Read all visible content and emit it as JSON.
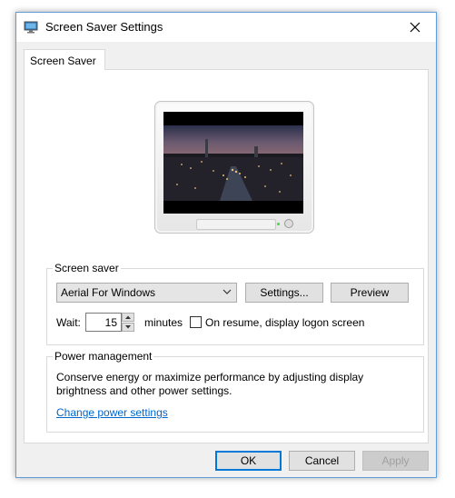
{
  "window": {
    "title": "Screen Saver Settings"
  },
  "tabs": [
    {
      "label": "Screen Saver"
    }
  ],
  "screen_saver": {
    "group_label": "Screen saver",
    "selected": "Aerial For Windows",
    "settings_label": "Settings...",
    "preview_label": "Preview",
    "wait_label": "Wait:",
    "wait_value": "15",
    "minutes_label": "minutes",
    "resume_label": "On resume, display logon screen",
    "resume_checked": false
  },
  "power": {
    "group_label": "Power management",
    "description": "Conserve energy or maximize performance by adjusting display brightness and other power settings.",
    "link_label": "Change power settings"
  },
  "footer": {
    "ok_label": "OK",
    "cancel_label": "Cancel",
    "apply_label": "Apply"
  },
  "colors": {
    "accent": "#0078d7",
    "link": "#0066cc",
    "window_border": "#5f9ed8"
  }
}
